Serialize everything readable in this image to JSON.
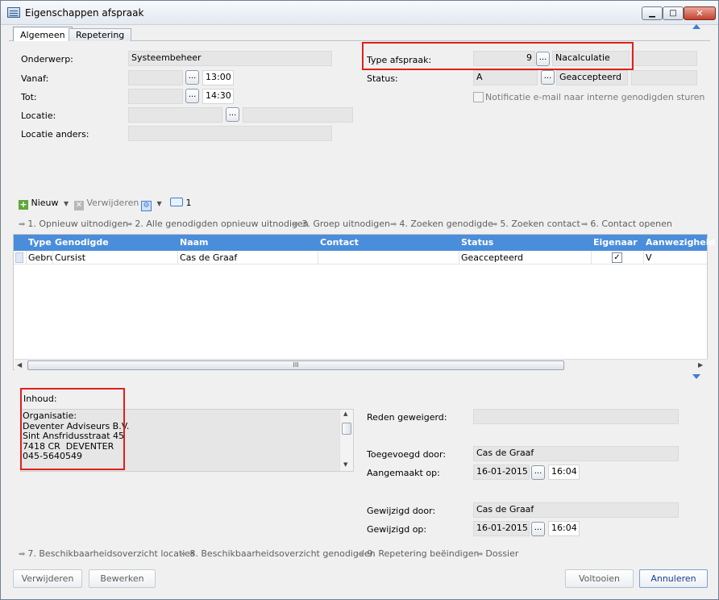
{
  "window": {
    "title": "Eigenschappen afspraak",
    "buttons": {
      "minimize": "▁",
      "maximize": "□",
      "close": "✕"
    }
  },
  "tabs": [
    {
      "label": "Algemeen"
    },
    {
      "label": "Repetering"
    }
  ],
  "general": {
    "onderwerp": {
      "label": "Onderwerp:",
      "value": "Systeembeheer"
    },
    "vanaf": {
      "label": "Vanaf:",
      "date": "",
      "time": "13:00"
    },
    "tot": {
      "label": "Tot:",
      "date": "",
      "time": "14:30"
    },
    "locatie": {
      "label": "Locatie:",
      "code": "",
      "name": ""
    },
    "locatie_anders": {
      "label": "Locatie anders:",
      "value": ""
    },
    "type_afspraak": {
      "label": "Type afspraak:",
      "code": "9",
      "name": "Nacalculatie",
      "extra": ""
    },
    "status": {
      "label": "Status:",
      "code": "A",
      "name": "Geaccepteerd",
      "extra": ""
    },
    "notificatie": {
      "label": "Notificatie e-mail naar interne genodigden sturen",
      "checked": false
    },
    "dots": "..."
  },
  "toolbar": {
    "nieuw": "Nieuw",
    "verwijderen": "Verwijderen",
    "counter": "1"
  },
  "actions_top": [
    "1. Opnieuw uitnodigen",
    "2. Alle genodigden opnieuw uitnodigen",
    "3. Groep uitnodigen",
    "4. Zoeken genodigde",
    "5. Zoeken contact",
    "6. Contact openen"
  ],
  "grid": {
    "columns": [
      "Type",
      "Genodigde",
      "Naam",
      "Contact",
      "Status",
      "Eigenaar",
      "Aanwezigheid"
    ],
    "rows": [
      {
        "type": "Gebru",
        "genodigde": "Cursist",
        "naam": "Cas de Graaf",
        "contact": "",
        "status": "Geaccepteerd",
        "eigenaar": true,
        "aanwezigheid": "V"
      }
    ],
    "scroll_grip": "III"
  },
  "inhoud": {
    "label": "Inhoud:",
    "text": "Organisatie:\nDeventer Adviseurs B.V.\nSint Ansfridusstraat 45\n7418 CR  DEVENTER\n045-5640549"
  },
  "details": {
    "reden_geweigerd": {
      "label": "Reden geweigerd:",
      "value": ""
    },
    "toegevoegd_door": {
      "label": "Toegevoegd door:",
      "value": "Cas de Graaf"
    },
    "aangemaakt_op": {
      "label": "Aangemaakt op:",
      "date": "16-01-2015",
      "time": "16:04"
    },
    "gewijzigd_door": {
      "label": "Gewijzigd door:",
      "value": "Cas de Graaf"
    },
    "gewijzigd_op": {
      "label": "Gewijzigd op:",
      "date": "16-01-2015",
      "time": "16:04"
    }
  },
  "actions_bottom": [
    "7. Beschikbaarheidsoverzicht locaties",
    "8. Beschikbaarheidsoverzicht genodigden",
    "9. Repetering beëindigen",
    "Dossier"
  ],
  "buttons": {
    "verwijderen": "Verwijderen",
    "bewerken": "Bewerken",
    "voltooien": "Voltooien",
    "annuleren": "Annuleren"
  },
  "colors": {
    "grid_header": "#4a8ddb",
    "highlight_box": "#e0201b",
    "field_bg": "#e6e6e6"
  }
}
